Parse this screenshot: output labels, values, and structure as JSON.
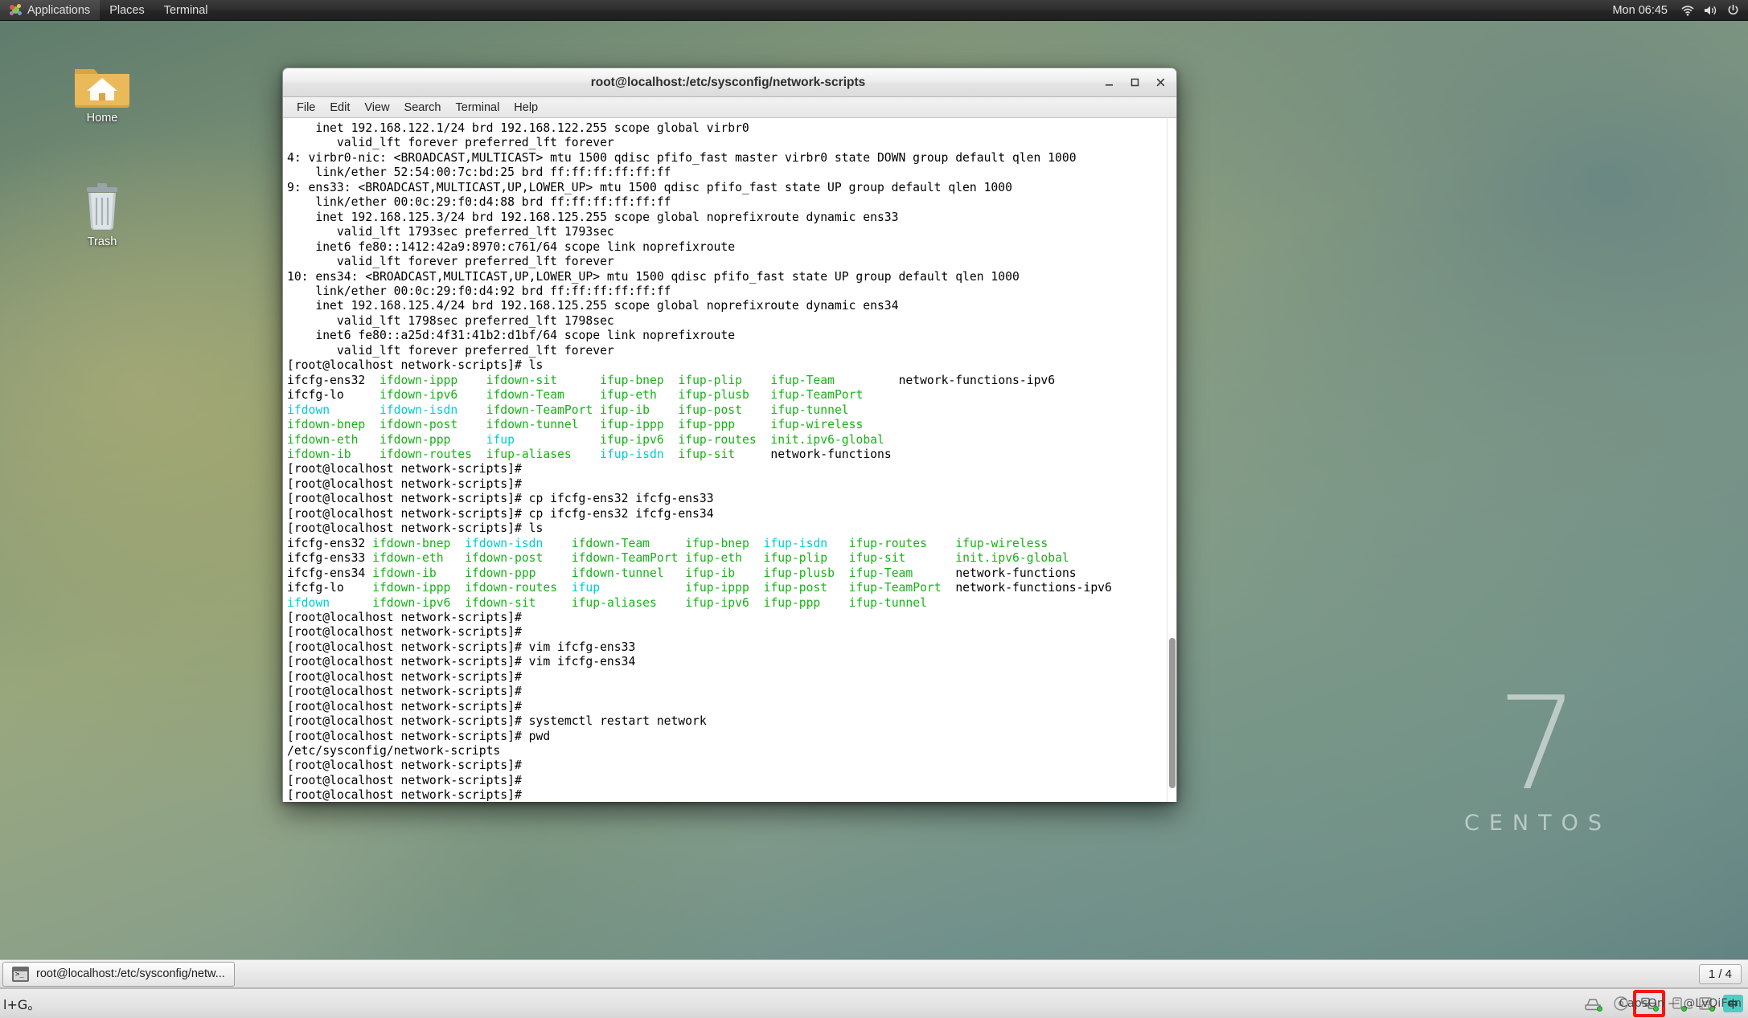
{
  "top_panel": {
    "applications": "Applications",
    "places": "Places",
    "terminal": "Terminal",
    "clock": "Mon 06:45",
    "tray": [
      "network-icon",
      "volume-icon",
      "power-icon"
    ]
  },
  "desktop": {
    "icons": [
      {
        "label": "Home",
        "icon": "home-folder-icon"
      },
      {
        "label": "Trash",
        "icon": "trash-can-icon"
      }
    ],
    "watermark_number": "7",
    "watermark_word": "CENTOS"
  },
  "window": {
    "title": "root@localhost:/etc/sysconfig/network-scripts",
    "minimize": "–",
    "maximize": "□",
    "close": "×",
    "menus": [
      "File",
      "Edit",
      "View",
      "Search",
      "Terminal",
      "Help"
    ]
  },
  "terminal": {
    "prompt": "[root@localhost network-scripts]# ",
    "lines": [
      [
        {
          "t": "    inet 192.168.122.1/24 brd 192.168.122.255 scope global virbr0",
          "c": "k"
        }
      ],
      [
        {
          "t": "       valid_lft forever preferred_lft forever",
          "c": "k"
        }
      ],
      [
        {
          "t": "4: virbr0-nic: <BROADCAST,MULTICAST> mtu 1500 qdisc pfifo_fast master virbr0 state DOWN group default qlen 1000",
          "c": "k"
        }
      ],
      [
        {
          "t": "    link/ether 52:54:00:7c:bd:25 brd ff:ff:ff:ff:ff:ff",
          "c": "k"
        }
      ],
      [
        {
          "t": "9: ens33: <BROADCAST,MULTICAST,UP,LOWER_UP> mtu 1500 qdisc pfifo_fast state UP group default qlen 1000",
          "c": "k"
        }
      ],
      [
        {
          "t": "    link/ether 00:0c:29:f0:d4:88 brd ff:ff:ff:ff:ff:ff",
          "c": "k"
        }
      ],
      [
        {
          "t": "    inet 192.168.125.3/24 brd 192.168.125.255 scope global noprefixroute dynamic ens33",
          "c": "k"
        }
      ],
      [
        {
          "t": "       valid_lft 1793sec preferred_lft 1793sec",
          "c": "k"
        }
      ],
      [
        {
          "t": "    inet6 fe80::1412:42a9:8970:c761/64 scope link noprefixroute",
          "c": "k"
        }
      ],
      [
        {
          "t": "       valid_lft forever preferred_lft forever",
          "c": "k"
        }
      ],
      [
        {
          "t": "10: ens34: <BROADCAST,MULTICAST,UP,LOWER_UP> mtu 1500 qdisc pfifo_fast state UP group default qlen 1000",
          "c": "k"
        }
      ],
      [
        {
          "t": "    link/ether 00:0c:29:f0:d4:92 brd ff:ff:ff:ff:ff:ff",
          "c": "k"
        }
      ],
      [
        {
          "t": "    inet 192.168.125.4/24 brd 192.168.125.255 scope global noprefixroute dynamic ens34",
          "c": "k"
        }
      ],
      [
        {
          "t": "       valid_lft 1798sec preferred_lft 1798sec",
          "c": "k"
        }
      ],
      [
        {
          "t": "    inet6 fe80::a25d:4f31:41b2:d1bf/64 scope link noprefixroute",
          "c": "k"
        }
      ],
      [
        {
          "t": "       valid_lft forever preferred_lft forever",
          "c": "k"
        }
      ],
      [
        {
          "t": "[root@localhost network-scripts]# ls",
          "c": "k"
        }
      ],
      [
        {
          "t": "ifcfg-ens32",
          "c": "k"
        },
        {
          "t": "  ",
          "c": "k"
        },
        {
          "t": "ifdown-ippp",
          "c": "g"
        },
        {
          "t": "    ",
          "c": "k"
        },
        {
          "t": "ifdown-sit",
          "c": "g"
        },
        {
          "t": "      ",
          "c": "k"
        },
        {
          "t": "ifup-bnep",
          "c": "g"
        },
        {
          "t": "  ",
          "c": "k"
        },
        {
          "t": "ifup-plip",
          "c": "g"
        },
        {
          "t": "    ",
          "c": "k"
        },
        {
          "t": "ifup-Team",
          "c": "g"
        },
        {
          "t": "         ",
          "c": "k"
        },
        {
          "t": "network-functions-ipv6",
          "c": "k"
        }
      ],
      [
        {
          "t": "ifcfg-lo",
          "c": "k"
        },
        {
          "t": "     ",
          "c": "k"
        },
        {
          "t": "ifdown-ipv6",
          "c": "g"
        },
        {
          "t": "    ",
          "c": "k"
        },
        {
          "t": "ifdown-Team",
          "c": "g"
        },
        {
          "t": "     ",
          "c": "k"
        },
        {
          "t": "ifup-eth",
          "c": "g"
        },
        {
          "t": "   ",
          "c": "k"
        },
        {
          "t": "ifup-plusb",
          "c": "g"
        },
        {
          "t": "   ",
          "c": "k"
        },
        {
          "t": "ifup-TeamPort",
          "c": "g"
        }
      ],
      [
        {
          "t": "ifdown",
          "c": "c"
        },
        {
          "t": "       ",
          "c": "k"
        },
        {
          "t": "ifdown-isdn",
          "c": "c"
        },
        {
          "t": "    ",
          "c": "k"
        },
        {
          "t": "ifdown-TeamPort",
          "c": "g"
        },
        {
          "t": " ",
          "c": "k"
        },
        {
          "t": "ifup-ib",
          "c": "g"
        },
        {
          "t": "    ",
          "c": "k"
        },
        {
          "t": "ifup-post",
          "c": "g"
        },
        {
          "t": "    ",
          "c": "k"
        },
        {
          "t": "ifup-tunnel",
          "c": "g"
        }
      ],
      [
        {
          "t": "ifdown-bnep",
          "c": "g"
        },
        {
          "t": "  ",
          "c": "k"
        },
        {
          "t": "ifdown-post",
          "c": "g"
        },
        {
          "t": "    ",
          "c": "k"
        },
        {
          "t": "ifdown-tunnel",
          "c": "g"
        },
        {
          "t": "   ",
          "c": "k"
        },
        {
          "t": "ifup-ippp",
          "c": "g"
        },
        {
          "t": "  ",
          "c": "k"
        },
        {
          "t": "ifup-ppp",
          "c": "g"
        },
        {
          "t": "     ",
          "c": "k"
        },
        {
          "t": "ifup-wireless",
          "c": "g"
        }
      ],
      [
        {
          "t": "ifdown-eth",
          "c": "g"
        },
        {
          "t": "   ",
          "c": "k"
        },
        {
          "t": "ifdown-ppp",
          "c": "g"
        },
        {
          "t": "     ",
          "c": "k"
        },
        {
          "t": "ifup",
          "c": "c"
        },
        {
          "t": "            ",
          "c": "k"
        },
        {
          "t": "ifup-ipv6",
          "c": "g"
        },
        {
          "t": "  ",
          "c": "k"
        },
        {
          "t": "ifup-routes",
          "c": "g"
        },
        {
          "t": "  ",
          "c": "k"
        },
        {
          "t": "init.ipv6-global",
          "c": "g"
        }
      ],
      [
        {
          "t": "ifdown-ib",
          "c": "g"
        },
        {
          "t": "    ",
          "c": "k"
        },
        {
          "t": "ifdown-routes",
          "c": "g"
        },
        {
          "t": "  ",
          "c": "k"
        },
        {
          "t": "ifup-aliases",
          "c": "g"
        },
        {
          "t": "    ",
          "c": "k"
        },
        {
          "t": "ifup-isdn",
          "c": "c"
        },
        {
          "t": "  ",
          "c": "k"
        },
        {
          "t": "ifup-sit",
          "c": "g"
        },
        {
          "t": "     ",
          "c": "k"
        },
        {
          "t": "network-functions",
          "c": "k"
        }
      ],
      [
        {
          "t": "[root@localhost network-scripts]# ",
          "c": "k"
        }
      ],
      [
        {
          "t": "[root@localhost network-scripts]# ",
          "c": "k"
        }
      ],
      [
        {
          "t": "[root@localhost network-scripts]# cp ifcfg-ens32 ifcfg-ens33",
          "c": "k"
        }
      ],
      [
        {
          "t": "[root@localhost network-scripts]# cp ifcfg-ens32 ifcfg-ens34",
          "c": "k"
        }
      ],
      [
        {
          "t": "[root@localhost network-scripts]# ls",
          "c": "k"
        }
      ],
      [
        {
          "t": "ifcfg-ens32",
          "c": "k"
        },
        {
          "t": " ",
          "c": "k"
        },
        {
          "t": "ifdown-bnep",
          "c": "g"
        },
        {
          "t": "  ",
          "c": "k"
        },
        {
          "t": "ifdown-isdn",
          "c": "c"
        },
        {
          "t": "    ",
          "c": "k"
        },
        {
          "t": "ifdown-Team",
          "c": "g"
        },
        {
          "t": "     ",
          "c": "k"
        },
        {
          "t": "ifup-bnep",
          "c": "g"
        },
        {
          "t": "  ",
          "c": "k"
        },
        {
          "t": "ifup-isdn",
          "c": "c"
        },
        {
          "t": "   ",
          "c": "k"
        },
        {
          "t": "ifup-routes",
          "c": "g"
        },
        {
          "t": "    ",
          "c": "k"
        },
        {
          "t": "ifup-wireless",
          "c": "g"
        }
      ],
      [
        {
          "t": "ifcfg-ens33",
          "c": "k"
        },
        {
          "t": " ",
          "c": "k"
        },
        {
          "t": "ifdown-eth",
          "c": "g"
        },
        {
          "t": "   ",
          "c": "k"
        },
        {
          "t": "ifdown-post",
          "c": "g"
        },
        {
          "t": "    ",
          "c": "k"
        },
        {
          "t": "ifdown-TeamPort",
          "c": "g"
        },
        {
          "t": " ",
          "c": "k"
        },
        {
          "t": "ifup-eth",
          "c": "g"
        },
        {
          "t": "   ",
          "c": "k"
        },
        {
          "t": "ifup-plip",
          "c": "g"
        },
        {
          "t": "   ",
          "c": "k"
        },
        {
          "t": "ifup-sit",
          "c": "g"
        },
        {
          "t": "       ",
          "c": "k"
        },
        {
          "t": "init.ipv6-global",
          "c": "g"
        }
      ],
      [
        {
          "t": "ifcfg-ens34",
          "c": "k"
        },
        {
          "t": " ",
          "c": "k"
        },
        {
          "t": "ifdown-ib",
          "c": "g"
        },
        {
          "t": "    ",
          "c": "k"
        },
        {
          "t": "ifdown-ppp",
          "c": "g"
        },
        {
          "t": "     ",
          "c": "k"
        },
        {
          "t": "ifdown-tunnel",
          "c": "g"
        },
        {
          "t": "   ",
          "c": "k"
        },
        {
          "t": "ifup-ib",
          "c": "g"
        },
        {
          "t": "    ",
          "c": "k"
        },
        {
          "t": "ifup-plusb",
          "c": "g"
        },
        {
          "t": "  ",
          "c": "k"
        },
        {
          "t": "ifup-Team",
          "c": "g"
        },
        {
          "t": "      ",
          "c": "k"
        },
        {
          "t": "network-functions",
          "c": "k"
        }
      ],
      [
        {
          "t": "ifcfg-lo",
          "c": "k"
        },
        {
          "t": "    ",
          "c": "k"
        },
        {
          "t": "ifdown-ippp",
          "c": "g"
        },
        {
          "t": "  ",
          "c": "k"
        },
        {
          "t": "ifdown-routes",
          "c": "g"
        },
        {
          "t": "  ",
          "c": "k"
        },
        {
          "t": "ifup",
          "c": "c"
        },
        {
          "t": "            ",
          "c": "k"
        },
        {
          "t": "ifup-ippp",
          "c": "g"
        },
        {
          "t": "  ",
          "c": "k"
        },
        {
          "t": "ifup-post",
          "c": "g"
        },
        {
          "t": "   ",
          "c": "k"
        },
        {
          "t": "ifup-TeamPort",
          "c": "g"
        },
        {
          "t": "  ",
          "c": "k"
        },
        {
          "t": "network-functions-ipv6",
          "c": "k"
        }
      ],
      [
        {
          "t": "ifdown",
          "c": "c"
        },
        {
          "t": "      ",
          "c": "k"
        },
        {
          "t": "ifdown-ipv6",
          "c": "g"
        },
        {
          "t": "  ",
          "c": "k"
        },
        {
          "t": "ifdown-sit",
          "c": "g"
        },
        {
          "t": "     ",
          "c": "k"
        },
        {
          "t": "ifup-aliases",
          "c": "g"
        },
        {
          "t": "    ",
          "c": "k"
        },
        {
          "t": "ifup-ipv6",
          "c": "g"
        },
        {
          "t": "  ",
          "c": "k"
        },
        {
          "t": "ifup-ppp",
          "c": "g"
        },
        {
          "t": "    ",
          "c": "k"
        },
        {
          "t": "ifup-tunnel",
          "c": "g"
        }
      ],
      [
        {
          "t": "[root@localhost network-scripts]# ",
          "c": "k"
        }
      ],
      [
        {
          "t": "[root@localhost network-scripts]# ",
          "c": "k"
        }
      ],
      [
        {
          "t": "[root@localhost network-scripts]# vim ifcfg-ens33",
          "c": "k"
        }
      ],
      [
        {
          "t": "[root@localhost network-scripts]# vim ifcfg-ens34",
          "c": "k"
        }
      ],
      [
        {
          "t": "[root@localhost network-scripts]# ",
          "c": "k"
        }
      ],
      [
        {
          "t": "[root@localhost network-scripts]# ",
          "c": "k"
        }
      ],
      [
        {
          "t": "[root@localhost network-scripts]# ",
          "c": "k"
        }
      ],
      [
        {
          "t": "[root@localhost network-scripts]# systemctl restart network",
          "c": "k"
        }
      ],
      [
        {
          "t": "[root@localhost network-scripts]# pwd",
          "c": "k"
        }
      ],
      [
        {
          "t": "/etc/sysconfig/network-scripts",
          "c": "k"
        }
      ],
      [
        {
          "t": "[root@localhost network-scripts]# ",
          "c": "k"
        }
      ],
      [
        {
          "t": "[root@localhost network-scripts]# ",
          "c": "k"
        }
      ],
      [
        {
          "t": "[root@localhost network-scripts]# ",
          "c": "k"
        }
      ],
      [
        {
          "t": "[root@localhost network-scripts]# ",
          "c": "k",
          "cursor": true
        }
      ]
    ]
  },
  "taskbar": {
    "window_button": "root@localhost:/etc/sysconfig/netw...",
    "workspace": "1 / 4"
  },
  "tray_panel": {
    "ime_text": "l+G。",
    "ime_label": "CapsOn — @LvQiFen",
    "ime_badge": "中",
    "highlighted_icon": "network-connection-icon",
    "icons": [
      "disk-icon",
      "optical-disc-icon",
      "network-connection-icon",
      "usb-icon",
      "floppy-icon"
    ]
  },
  "colors": {
    "green": "#18b218",
    "cyan": "#00cdcd",
    "black": "#000000",
    "highlight_red": "#f21717",
    "panel_dark": "#2e2e2e"
  }
}
